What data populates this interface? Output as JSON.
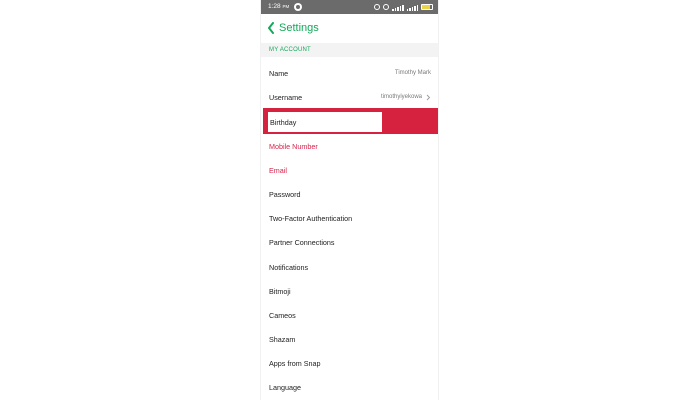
{
  "status_bar": {
    "time": "1:28",
    "time_suffix": "PM"
  },
  "header": {
    "title": "Settings"
  },
  "section": {
    "title": "MY ACCOUNT"
  },
  "rows": [
    {
      "label": "Name",
      "value": "Timothy Mark"
    },
    {
      "label": "Username",
      "value": "timothyiyekowa"
    },
    {
      "label": "Birthday"
    },
    {
      "label": "Mobile Number"
    },
    {
      "label": "Email"
    },
    {
      "label": "Password"
    },
    {
      "label": "Two-Factor Authentication"
    },
    {
      "label": "Partner Connections"
    },
    {
      "label": "Notifications"
    },
    {
      "label": "Bitmoji"
    },
    {
      "label": "Cameos"
    },
    {
      "label": "Shazam"
    },
    {
      "label": "Apps from Snap"
    },
    {
      "label": "Language"
    }
  ],
  "colors": {
    "accent_green": "#14a85a",
    "alert_red": "#d6244b",
    "highlight_red": "#d6213f",
    "status_bar": "#6b6b6b"
  },
  "icons": {
    "back": "chevron-left-icon",
    "row_chevron": "chevron-right-icon"
  },
  "battery_level": 0.8
}
